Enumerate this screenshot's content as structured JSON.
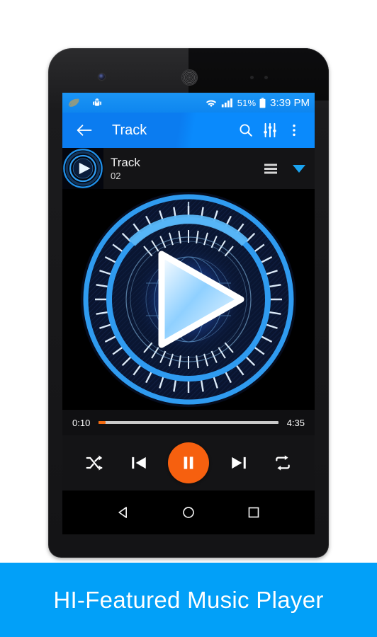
{
  "status_bar": {
    "notification_icons": [
      "leaf-icon",
      "android-bug-icon"
    ],
    "wifi_icon": "wifi-icon",
    "signal_icon": "signal-bars-icon",
    "battery_percent": "51%",
    "battery_icon": "battery-icon",
    "clock": "3:39 PM"
  },
  "app_bar": {
    "back_icon": "back-arrow-icon",
    "title": "Track",
    "search_icon": "search-icon",
    "equalizer_icon": "equalizer-icon",
    "overflow_icon": "overflow-menu-icon"
  },
  "track_row": {
    "thumbnail_icon": "album-art-play-icon",
    "title": "Track",
    "subtitle": "02",
    "queue_icon": "queue-list-icon",
    "expand_icon": "chevron-down-icon"
  },
  "artwork": {
    "icon": "play-triangle-icon",
    "description": "Futuristic HUD circular play button artwork"
  },
  "seek": {
    "elapsed": "0:10",
    "total": "4:35",
    "progress_percent": 4
  },
  "controls": {
    "shuffle_icon": "shuffle-icon",
    "previous_icon": "skip-previous-icon",
    "play_pause_icon": "pause-icon",
    "next_icon": "skip-next-icon",
    "repeat_icon": "repeat-icon"
  },
  "nav_bar": {
    "back_icon": "nav-back-triangle-icon",
    "home_icon": "nav-home-circle-icon",
    "recents_icon": "nav-recents-square-icon"
  },
  "banner": {
    "text": "HI-Featured Music Player"
  },
  "colors": {
    "app_bar_blue": "#0a8afc",
    "status_bar_blue": "#0e86ef",
    "banner_blue": "#02a0f8",
    "accent_orange": "#f6600f",
    "seek_track": "#c9c9c9",
    "screen_dark": "#141416",
    "expand_chevron_blue": "#1aa3f0"
  }
}
